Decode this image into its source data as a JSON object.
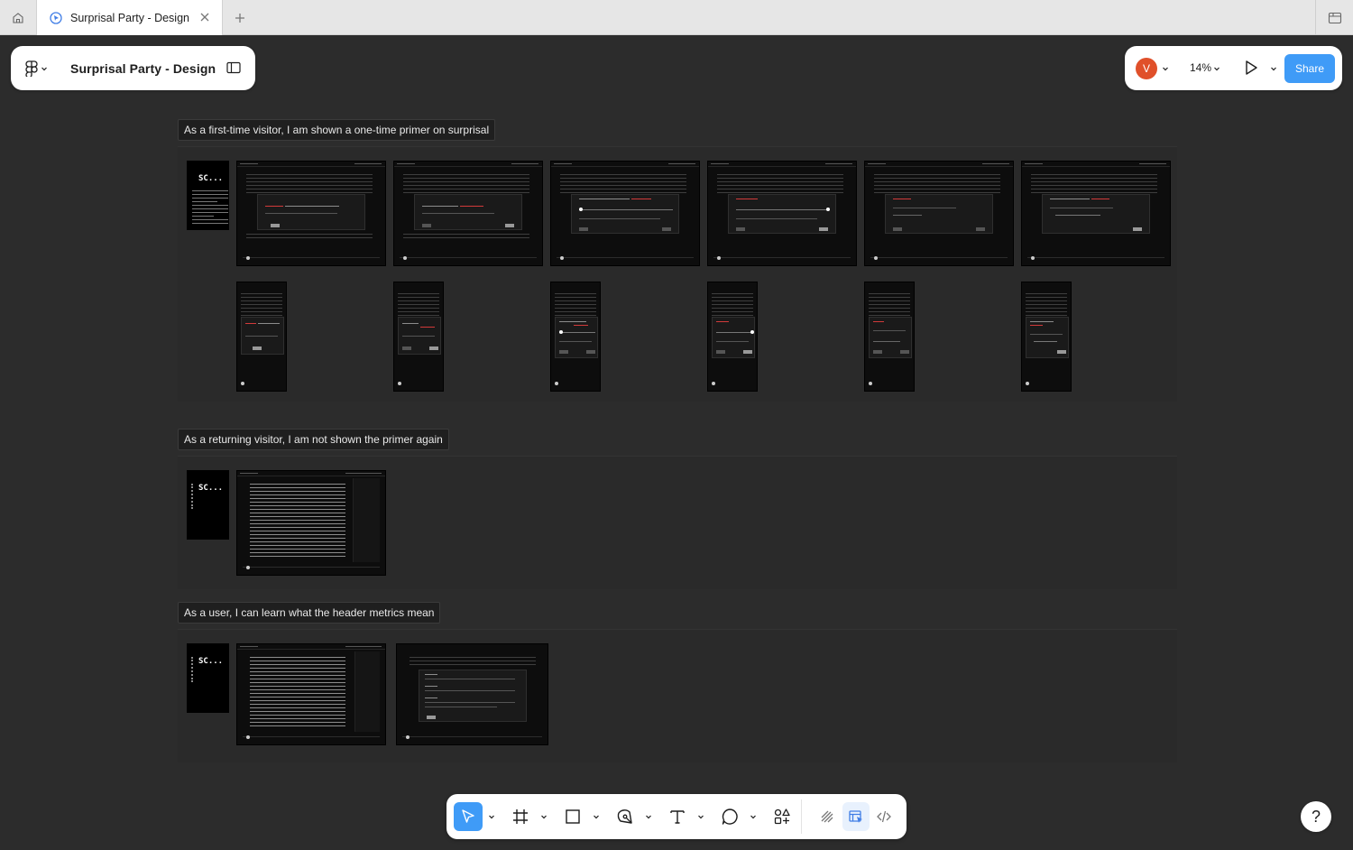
{
  "tab": {
    "title": "Surprisal Party - Design",
    "icon": "figma-design-icon"
  },
  "file_panel": {
    "menu_icon": "figma-logo-icon",
    "file_name": "Surprisal Party - Design",
    "sidebar_icon": "sidebar-toggle-icon"
  },
  "header_right": {
    "avatar_initial": "V",
    "avatar_color": "#e0502a",
    "zoom": "14%",
    "present_icon": "play-icon",
    "share_label": "Share",
    "share_color": "#3f9bf7"
  },
  "canvas": {
    "sections": [
      {
        "label": "As a first-time visitor, I am shown a one-time primer on surprisal"
      },
      {
        "label": "As a returning visitor, I am not shown the primer again"
      },
      {
        "label": "As a user, I can learn what the header metrics mean"
      }
    ],
    "cover_title": "SC..."
  },
  "toolbar": {
    "tools": [
      {
        "name": "move-tool",
        "icon": "cursor-icon",
        "active": true
      },
      {
        "name": "frame-tool",
        "icon": "frame-grid-icon"
      },
      {
        "name": "shape-tool",
        "icon": "rectangle-icon"
      },
      {
        "name": "pen-tool",
        "icon": "pen-icon"
      },
      {
        "name": "text-tool",
        "icon": "text-icon"
      },
      {
        "name": "comment-tool",
        "icon": "comment-icon"
      },
      {
        "name": "actions-tool",
        "icon": "shapes-plus-icon"
      }
    ],
    "modes": [
      {
        "name": "draw-mode",
        "icon": "draw-icon"
      },
      {
        "name": "design-mode",
        "icon": "design-mode-icon",
        "active": true
      },
      {
        "name": "dev-mode",
        "icon": "code-icon"
      }
    ]
  },
  "help": {
    "label": "?"
  }
}
